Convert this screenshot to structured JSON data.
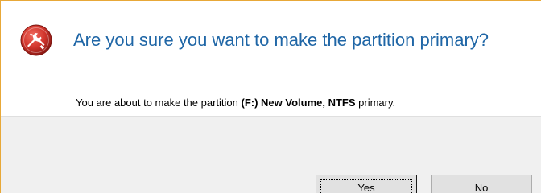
{
  "dialog": {
    "title": "Are you sure you want to make the partition primary?",
    "message": {
      "prefix": "You are about to make the partition ",
      "partition": "(F:) New Volume, NTFS",
      "suffix": " primary."
    },
    "icon": "question-wrench-icon",
    "buttons": {
      "yes_label": "Yes",
      "no_label": "No"
    },
    "colors": {
      "title": "#1f66a6",
      "icon_red": "#d0342c",
      "border_accent": "#e8a838",
      "footer_bg": "#f0f0f0"
    }
  }
}
